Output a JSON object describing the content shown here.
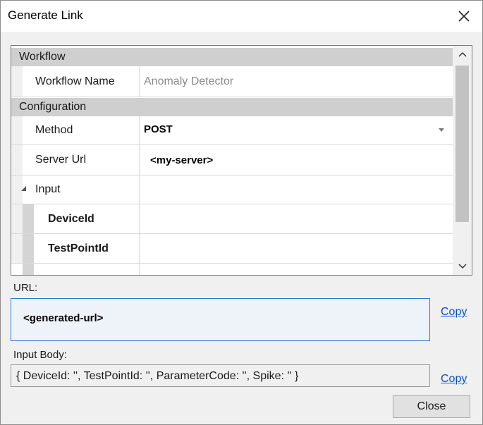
{
  "window": {
    "title": "Generate Link"
  },
  "grid": {
    "categories": {
      "workflow": "Workflow",
      "configuration": "Configuration"
    },
    "rows": {
      "workflow_name": {
        "name": "Workflow Name",
        "value": "Anomaly Detector"
      },
      "method": {
        "name": "Method",
        "value": "POST"
      },
      "server_url": {
        "name": "Server Url",
        "value": "<my-server>"
      },
      "input": {
        "name": "Input"
      },
      "device_id": {
        "name": "DeviceId",
        "value": ""
      },
      "test_point_id": {
        "name": "TestPointId",
        "value": ""
      }
    }
  },
  "url": {
    "label": "URL:",
    "value": "<generated-url>",
    "copy_label": "Copy"
  },
  "input_body": {
    "label": "Input Body:",
    "value": "{ DeviceId: '', TestPointId: '', ParameterCode: '', Spike: '' }",
    "copy_label": "Copy"
  },
  "buttons": {
    "close_label": "Close"
  },
  "colors": {
    "link": "#0b4fc2",
    "focus_border": "#2b79d6",
    "category_bg": "#cfcfcf"
  }
}
